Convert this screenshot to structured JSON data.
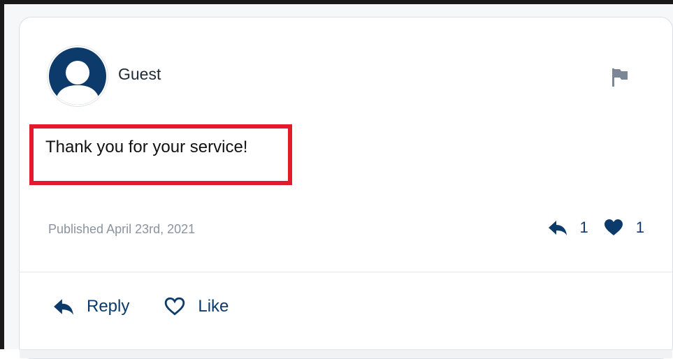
{
  "comment": {
    "author": "Guest",
    "text": "Thank you for your service!",
    "published": "Published April 23rd, 2021",
    "reply_count": "1",
    "like_count": "1"
  },
  "actions": {
    "reply_label": "Reply",
    "like_label": "Like"
  },
  "icons": {
    "avatar": "user-avatar-icon",
    "flag": "flag-icon",
    "reply": "reply-arrow-icon",
    "like_filled": "heart-filled-icon",
    "like_outline": "heart-outline-icon"
  },
  "colors": {
    "primary": "#0b3a6b",
    "highlight_box": "#e21b2a",
    "muted_text": "#8a939e"
  }
}
